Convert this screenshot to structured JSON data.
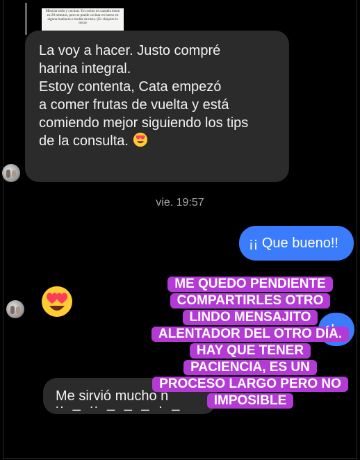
{
  "quoted_message": {
    "text": "Mezclar todo y cocinar. Yo cocino en cazuela essen en 20 minutos, pero se puede cocinar en horno en alguna budinera o molde de torta. (Es chiquito la torta)"
  },
  "messages": [
    {
      "id": "incoming-1",
      "text": "La voy a hacer. Justo compré\nharina integral.\nEstoy contenta, Cata empezó\na comer frutas de vuelta y está\ncomiendo mejor siguiendo los tips\nde la consulta."
    },
    {
      "id": "timestamp",
      "text": "vie. 19:57"
    },
    {
      "id": "outgoing-1",
      "text": "¡¡ Que bueno!!"
    },
    {
      "id": "incoming-emoji",
      "emoji": "heart-eyes"
    },
    {
      "id": "outgoing-2-partial",
      "text": "!"
    },
    {
      "id": "incoming-2-partial",
      "text": "Me sirvió mucho n"
    }
  ],
  "story_overlay": {
    "lines": [
      "ME QUEDO PENDIENTE",
      "COMPARTIRLES OTRO",
      "LINDO MENSAJITO",
      "ALENTADOR DEL OTRO DÍA.",
      "HAY QUE TENER",
      "PACIENCIA, ES UN",
      "PROCESO LARGO PERO NO",
      "IMPOSIBLE"
    ],
    "background": "#b43ad6",
    "text_color": "#ffffff"
  },
  "colors": {
    "background": "#000000",
    "incoming_bubble": "#2b2b2b",
    "outgoing_bubble": "#3a7cfb",
    "timestamp": "#a9a9a9"
  }
}
